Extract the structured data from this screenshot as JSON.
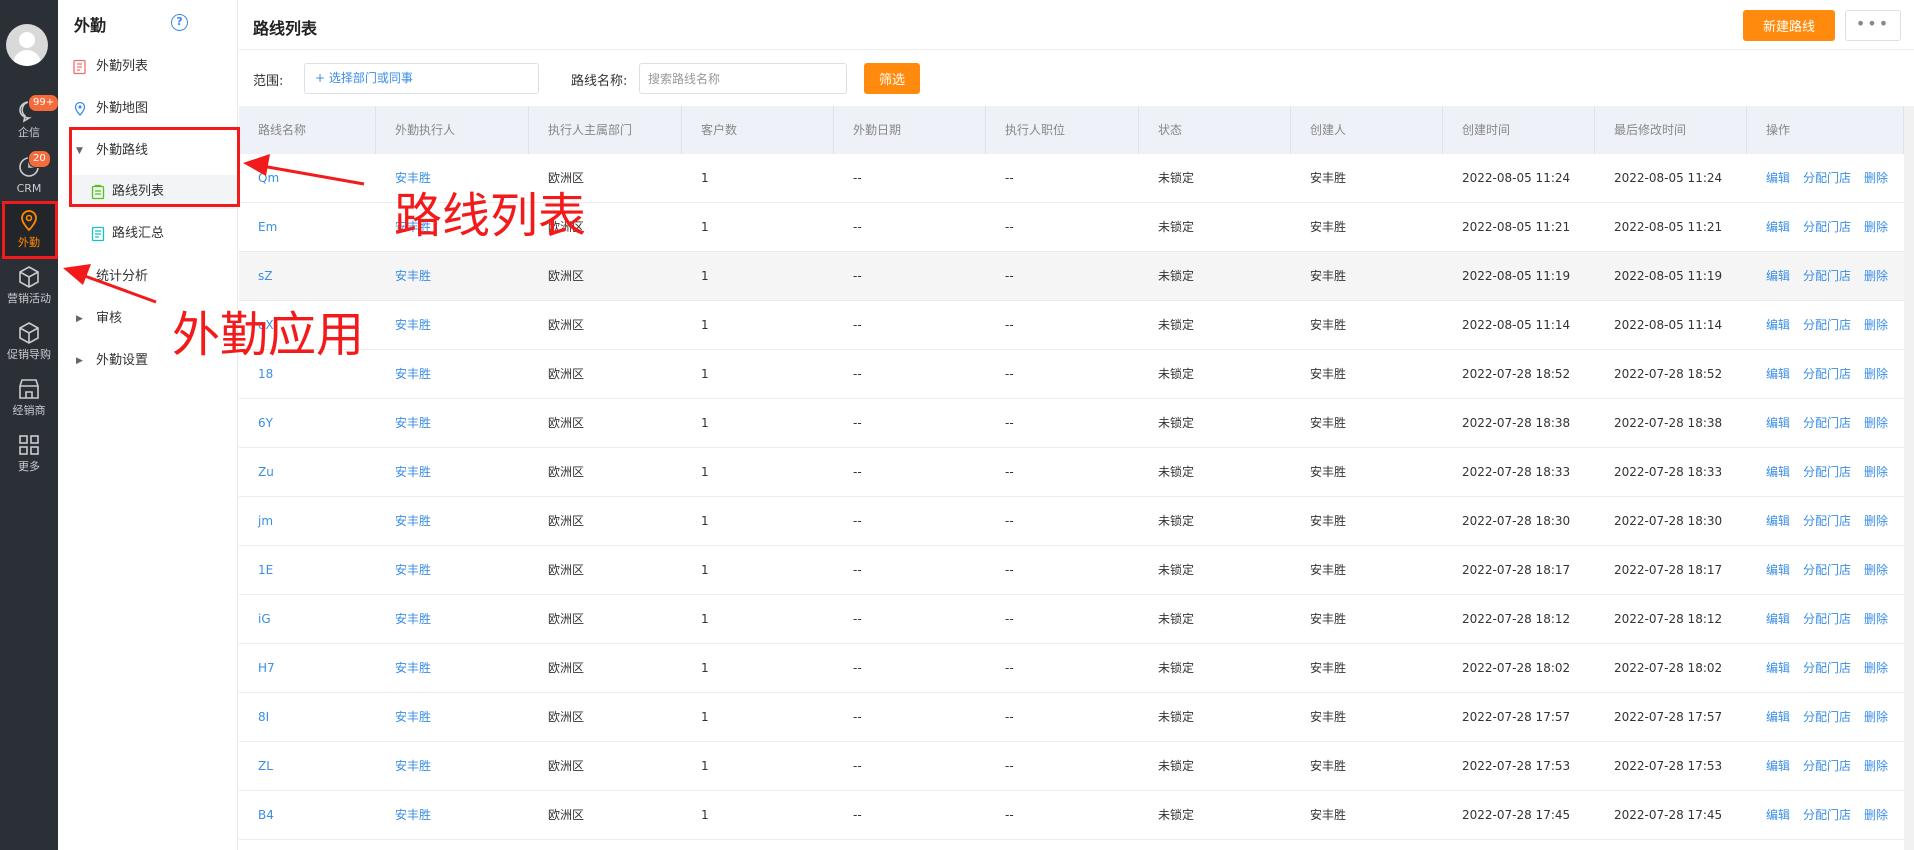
{
  "rail": {
    "items": [
      {
        "label": "企信",
        "badge": "99+"
      },
      {
        "label": "CRM",
        "badge": "20"
      },
      {
        "label": "外勤",
        "badge": ""
      },
      {
        "label": "营销活动",
        "badge": ""
      },
      {
        "label": "促销导购",
        "badge": ""
      },
      {
        "label": "经销商",
        "badge": ""
      },
      {
        "label": "更多",
        "badge": ""
      }
    ]
  },
  "sidebar": {
    "title": "外勤",
    "help_glyph": "?",
    "items": [
      {
        "label": "外勤列表"
      },
      {
        "label": "外勤地图"
      },
      {
        "label": "外勤路线"
      },
      {
        "label": "路线列表"
      },
      {
        "label": "路线汇总"
      },
      {
        "label": "统计分析"
      },
      {
        "label": "审核"
      },
      {
        "label": "外勤设置"
      }
    ]
  },
  "header": {
    "title": "路线列表",
    "new_button": "新建路线",
    "more_button": "•••"
  },
  "filter": {
    "range_label": "范围:",
    "range_value": "+ 选择部门或同事",
    "name_label": "路线名称:",
    "name_placeholder": "搜索路线名称",
    "filter_button": "筛选"
  },
  "table": {
    "columns": [
      "路线名称",
      "外勤执行人",
      "执行人主属部门",
      "客户数",
      "外勤日期",
      "执行人职位",
      "状态",
      "创建人",
      "创建时间",
      "最后修改时间",
      "操作"
    ],
    "actions": [
      "编辑",
      "分配门店",
      "删除"
    ],
    "rows": [
      [
        "Qm",
        "安丰胜",
        "欧洲区",
        "1",
        "--",
        "--",
        "未锁定",
        "安丰胜",
        "2022-08-05 11:24",
        "2022-08-05 11:24"
      ],
      [
        "Em",
        "安丰胜",
        "欧洲区",
        "1",
        "--",
        "--",
        "未锁定",
        "安丰胜",
        "2022-08-05 11:21",
        "2022-08-05 11:21"
      ],
      [
        "sZ",
        "安丰胜",
        "欧洲区",
        "1",
        "--",
        "--",
        "未锁定",
        "安丰胜",
        "2022-08-05 11:19",
        "2022-08-05 11:19"
      ],
      [
        "eX",
        "安丰胜",
        "欧洲区",
        "1",
        "--",
        "--",
        "未锁定",
        "安丰胜",
        "2022-08-05 11:14",
        "2022-08-05 11:14"
      ],
      [
        "18",
        "安丰胜",
        "欧洲区",
        "1",
        "--",
        "--",
        "未锁定",
        "安丰胜",
        "2022-07-28 18:52",
        "2022-07-28 18:52"
      ],
      [
        "6Y",
        "安丰胜",
        "欧洲区",
        "1",
        "--",
        "--",
        "未锁定",
        "安丰胜",
        "2022-07-28 18:38",
        "2022-07-28 18:38"
      ],
      [
        "Zu",
        "安丰胜",
        "欧洲区",
        "1",
        "--",
        "--",
        "未锁定",
        "安丰胜",
        "2022-07-28 18:33",
        "2022-07-28 18:33"
      ],
      [
        "jm",
        "安丰胜",
        "欧洲区",
        "1",
        "--",
        "--",
        "未锁定",
        "安丰胜",
        "2022-07-28 18:30",
        "2022-07-28 18:30"
      ],
      [
        "1E",
        "安丰胜",
        "欧洲区",
        "1",
        "--",
        "--",
        "未锁定",
        "安丰胜",
        "2022-07-28 18:17",
        "2022-07-28 18:17"
      ],
      [
        "iG",
        "安丰胜",
        "欧洲区",
        "1",
        "--",
        "--",
        "未锁定",
        "安丰胜",
        "2022-07-28 18:12",
        "2022-07-28 18:12"
      ],
      [
        "H7",
        "安丰胜",
        "欧洲区",
        "1",
        "--",
        "--",
        "未锁定",
        "安丰胜",
        "2022-07-28 18:02",
        "2022-07-28 18:02"
      ],
      [
        "8I",
        "安丰胜",
        "欧洲区",
        "1",
        "--",
        "--",
        "未锁定",
        "安丰胜",
        "2022-07-28 17:57",
        "2022-07-28 17:57"
      ],
      [
        "ZL",
        "安丰胜",
        "欧洲区",
        "1",
        "--",
        "--",
        "未锁定",
        "安丰胜",
        "2022-07-28 17:53",
        "2022-07-28 17:53"
      ],
      [
        "B4",
        "安丰胜",
        "欧洲区",
        "1",
        "--",
        "--",
        "未锁定",
        "安丰胜",
        "2022-07-28 17:45",
        "2022-07-28 17:45"
      ]
    ]
  },
  "annotations": {
    "route_list_text": "路线列表",
    "field_app_text": "外勤应用"
  },
  "colors": {
    "accent_orange": "#ff8a0d",
    "link_blue": "#3a8ee6",
    "annotation_red": "#f21a1a",
    "rail_bg": "#2b2f36"
  }
}
